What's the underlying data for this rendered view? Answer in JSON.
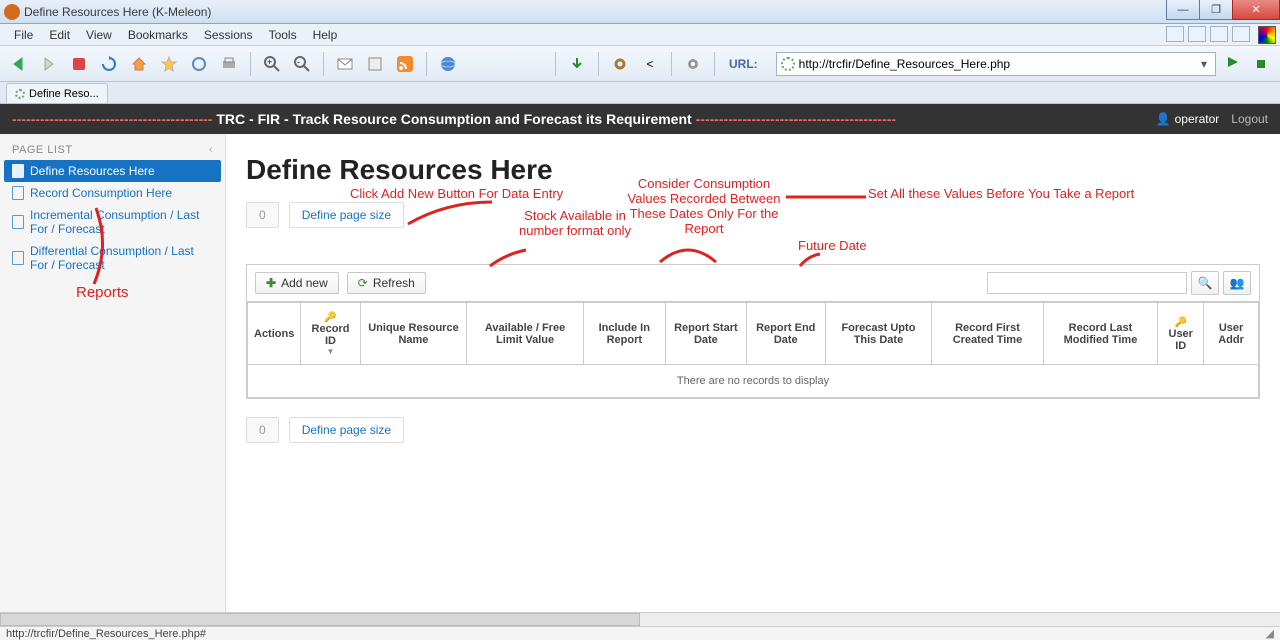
{
  "window": {
    "title": "Define Resources Here (K-Meleon)"
  },
  "menubar": [
    "File",
    "Edit",
    "View",
    "Bookmarks",
    "Sessions",
    "Tools",
    "Help"
  ],
  "url": {
    "label": "URL:",
    "value": "http://trcfir/Define_Resources_Here.php"
  },
  "tab": {
    "label": "Define Reso..."
  },
  "banner": {
    "dashes": "-------------------------------------------",
    "title": " TRC - FIR - Track Resource Consumption and Forecast its Requirement ",
    "user": "operator",
    "logout": "Logout"
  },
  "sidebar": {
    "header": "PAGE LIST",
    "items": [
      {
        "label": "Define Resources Here"
      },
      {
        "label": "Record Consumption Here"
      },
      {
        "label": "Incremental Consumption / Last For / Forecast"
      },
      {
        "label": "Differential Consumption / Last For / Forecast"
      }
    ]
  },
  "annotations": {
    "reports": "Reports",
    "clickAdd": "Click Add New Button For Data Entry",
    "stock": "Stock Available in number format only",
    "consider": "Consider Consumption Values Recorded Between These Dates Only For the Report",
    "future": "Future Date",
    "setAll": "Set All these Values Before You Take a Report"
  },
  "page": {
    "title": "Define Resources Here",
    "pagerCount": "0",
    "pageSize": "Define page size",
    "addNew": "Add new",
    "refresh": "Refresh",
    "emptyMsg": "There are no records to display",
    "columns": [
      "Actions",
      "Record ID",
      "Unique Resource Name",
      "Available / Free Limit Value",
      "Include In Report",
      "Report Start Date",
      "Report End Date",
      "Forecast Upto This Date",
      "Record First Created Time",
      "Record Last Modified Time",
      "User ID",
      "User Addr"
    ]
  },
  "status": {
    "text": "http://trcfir/Define_Resources_Here.php#"
  }
}
